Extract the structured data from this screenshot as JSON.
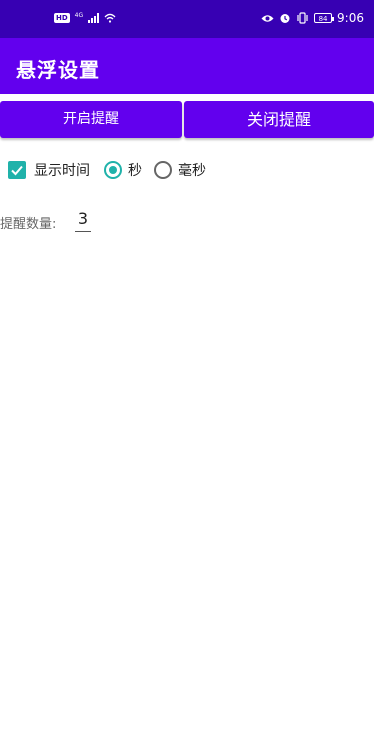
{
  "status_bar": {
    "hd": "HD",
    "net": "4G",
    "battery": "84",
    "time": "9:06",
    "icons": [
      "eye-icon",
      "alarm-icon",
      "vibrate-icon"
    ]
  },
  "app_bar": {
    "title": "悬浮设置"
  },
  "buttons": {
    "start": "开启提醒",
    "stop": "关闭提醒"
  },
  "options": {
    "show_time_label": "显示时间",
    "show_time_checked": true,
    "unit_seconds_label": "秒",
    "unit_ms_label": "毫秒",
    "selected_unit": "秒"
  },
  "reminder": {
    "count_label": "提醒数量:",
    "count_value": "3"
  },
  "colors": {
    "status_bar": "#3700b3",
    "app_bar": "#6200ee",
    "accent": "#20b2aa"
  }
}
